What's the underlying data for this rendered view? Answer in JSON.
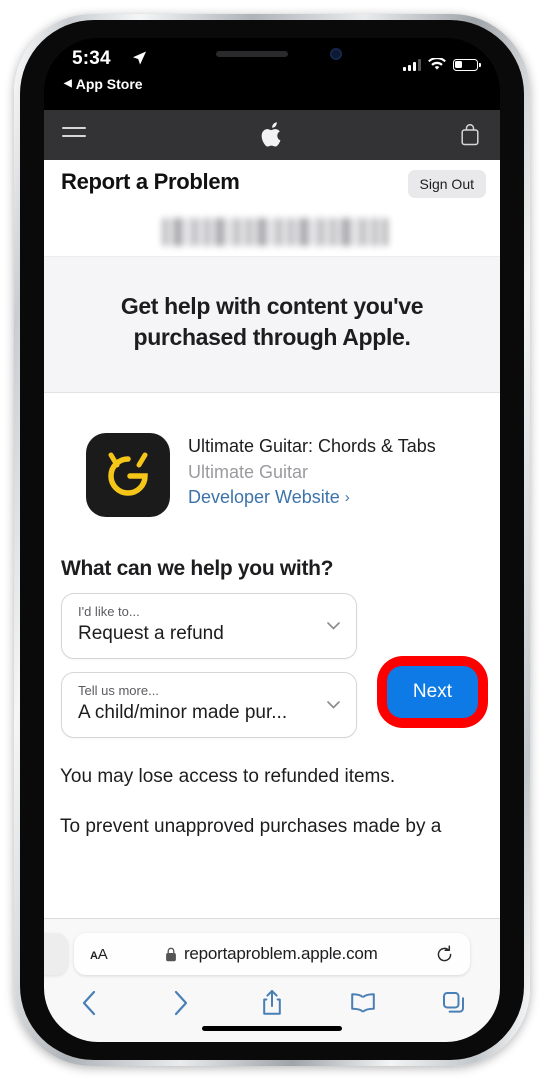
{
  "status_bar": {
    "time": "5:34",
    "location_icon": "location-arrow-icon",
    "back_label": "App Store",
    "back_arrow": "◀",
    "signal_icon": "cellular-signal-icon",
    "wifi_icon": "wifi-icon",
    "battery_icon": "battery-icon"
  },
  "apple_nav": {
    "menu_icon": "hamburger-menu-icon",
    "logo_icon": "apple-logo-icon",
    "bag_icon": "shopping-bag-icon"
  },
  "page_header": {
    "title": "Report a Problem",
    "sign_out_label": "Sign Out"
  },
  "account_bar": {
    "redacted": true,
    "note": "blurred Apple ID email"
  },
  "hero": {
    "heading_line1": "Get help with content you've",
    "heading_line2": "purchased through Apple."
  },
  "app": {
    "icon_name": "ultimate-guitar-app-icon",
    "icon_background": "#1b1b1b",
    "icon_mark_color": "#f5c518",
    "name": "Ultimate Guitar: Chords & Tabs",
    "developer": "Ultimate Guitar",
    "developer_link_label": "Developer Website",
    "developer_link_chevron": "›"
  },
  "form": {
    "heading": "What can we help you with?",
    "field1": {
      "label": "I'd like to...",
      "value": "Request a refund",
      "chevron_icon": "chevron-down-icon"
    },
    "field2": {
      "label": "Tell us more...",
      "value": "A child/minor made pur...",
      "chevron_icon": "chevron-down-icon"
    },
    "next_label": "Next",
    "next_color": "#0d7ae5",
    "highlight_color": "#ff0000"
  },
  "body_copy": {
    "line1": "You may lose access to refunded items.",
    "line2": "To prevent unapproved purchases made by a"
  },
  "safari": {
    "text_size_label": "AA",
    "lock_icon": "lock-icon",
    "url": "reportaproblem.apple.com",
    "reload_icon": "reload-icon",
    "toolbar": [
      {
        "name": "back-button",
        "icon": "chevron-left-icon"
      },
      {
        "name": "forward-button",
        "icon": "chevron-right-icon"
      },
      {
        "name": "share-button",
        "icon": "share-icon"
      },
      {
        "name": "bookmarks-button",
        "icon": "book-icon"
      },
      {
        "name": "tabs-button",
        "icon": "tabs-icon"
      }
    ],
    "accent": "#4a7fb5"
  }
}
